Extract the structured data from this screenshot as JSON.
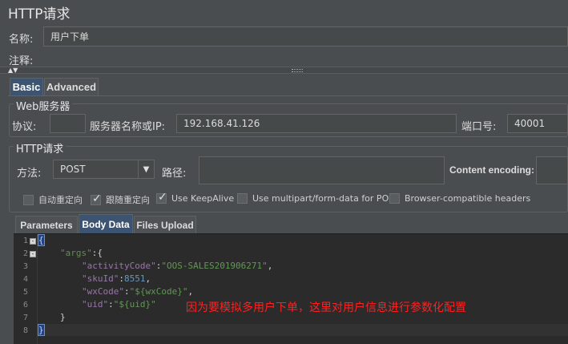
{
  "panel": {
    "title": "HTTP请求",
    "name_label": "名称:",
    "name_value": "用户下单",
    "comment_label": "注释:",
    "comment_value": ""
  },
  "config_tabs": [
    {
      "label": "Basic",
      "active": true
    },
    {
      "label": "Advanced",
      "active": false
    }
  ],
  "web_server": {
    "group_title": "Web服务器",
    "protocol_label": "协议:",
    "protocol_value": "",
    "server_label": "服务器名称或IP:",
    "server_value": "192.168.41.126",
    "port_label": "端口号:",
    "port_value": "40001"
  },
  "http_request": {
    "group_title": "HTTP请求",
    "method_label": "方法:",
    "method_value": "POST",
    "path_label": "路径:",
    "path_value": "",
    "encoding_label": "Content encoding:",
    "encoding_value": ""
  },
  "options": [
    {
      "label": "自动重定向",
      "checked": false
    },
    {
      "label": "跟随重定向",
      "checked": true
    },
    {
      "label": "Use KeepAlive",
      "checked": true
    },
    {
      "label": "Use multipart/form-data for POST",
      "checked": false
    },
    {
      "label": "Browser-compatible headers",
      "checked": false
    }
  ],
  "data_tabs": [
    {
      "label": "Parameters",
      "active": false
    },
    {
      "label": "Body Data",
      "active": true
    },
    {
      "label": "Files Upload",
      "active": false
    }
  ],
  "editor": {
    "line_numbers": [
      "1",
      "2",
      "3",
      "4",
      "5",
      "6",
      "7",
      "8"
    ],
    "lines": {
      "l1": "{",
      "l2_key": "\"args\"",
      "l2_rest": ":{",
      "l3_key": "\"activityCode\"",
      "l3_sep": ":",
      "l3_val": "\"OOS-SALES201906271\"",
      "l3_end": ",",
      "l4_key": "\"skuId\"",
      "l4_sep": ":",
      "l4_val": "8551",
      "l4_end": ",",
      "l5_key": "\"wxCode\"",
      "l5_sep": ":",
      "l5_val": "\"${wxCode}\"",
      "l5_end": ",",
      "l6_key": "\"uid\"",
      "l6_sep": ":",
      "l6_val": "\"${uid}\"",
      "l7": "}",
      "l8": "}"
    },
    "annotation": "因为要模拟多用户下单，这里对用户信息进行参数化配置"
  },
  "colors": {
    "background": "#4a4d50",
    "editor_background": "#2b2b2b",
    "active_tab": "#3c5472",
    "annotation": "#ff2020",
    "json_key": "#9876aa",
    "json_string": "#6a8759",
    "json_number": "#6897bb"
  },
  "icons": {
    "splitter": "splitter-grip-icon",
    "method_dropdown": "chevron-down-icon",
    "fold": "fold-minus-icon"
  }
}
